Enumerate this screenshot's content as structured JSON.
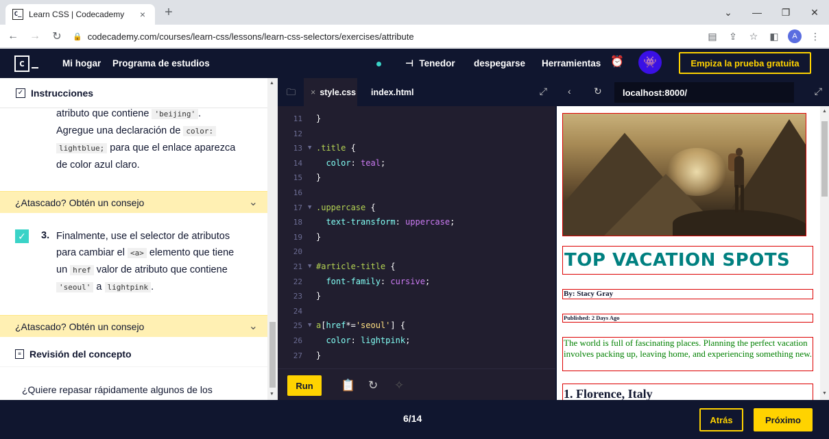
{
  "browser": {
    "tab_title": "Learn CSS | Codecademy",
    "favicon_text": "C_",
    "url": "codecademy.com/courses/learn-css/lessons/learn-css-selectors/exercises/attribute",
    "profile_initial": "A"
  },
  "header": {
    "logo_text": "c",
    "home": "Mi hogar",
    "catalog": "Programa de estudios",
    "fork": "Tenedor",
    "takeoff": "despegarse",
    "tools": "Herramientas",
    "trial_button": "Empiza la prueba gratuita"
  },
  "instructions": {
    "heading": "Instrucciones",
    "step2_text_a": "atributo que contiene",
    "step2_code_a": "'beijing'",
    "step2_text_b": "Agregue una declaración de",
    "step2_code_b": "color:",
    "step2_code_c": "lightblue;",
    "step2_text_c": "para que el enlace aparezca",
    "step2_text_d": "de color azul claro.",
    "hint_label": "¿Atascado? Obtén un consejo",
    "step3_num": "3.",
    "step3_text_a": "Finalmente, use el selector de atributos",
    "step3_text_b": "para cambiar el",
    "step3_code_a": "<a>",
    "step3_text_c": "elemento que tiene",
    "step3_text_d": "un",
    "step3_code_b": "href",
    "step3_text_e": "valor de atributo que contiene",
    "step3_code_c": "'seoul'",
    "step3_text_f": "a",
    "step3_code_d": "lightpink",
    "concept_heading": "Revisión del concepto",
    "concept_text": "¿Quiere repasar rápidamente algunos de los conceptos"
  },
  "editor": {
    "tabs": [
      "style.css",
      "index.html"
    ],
    "lines": [
      {
        "n": "11",
        "fold": false,
        "parts": [
          [
            "punc",
            "}"
          ]
        ]
      },
      {
        "n": "12",
        "fold": false,
        "parts": []
      },
      {
        "n": "13",
        "fold": true,
        "parts": [
          [
            "sel",
            ".title"
          ],
          [
            "punc",
            " {"
          ]
        ]
      },
      {
        "n": "14",
        "fold": false,
        "parts": [
          [
            "prop",
            "  color"
          ],
          [
            "punc",
            ": "
          ],
          [
            "val",
            "teal"
          ],
          [
            "punc",
            ";"
          ]
        ]
      },
      {
        "n": "15",
        "fold": false,
        "parts": [
          [
            "punc",
            "}"
          ]
        ]
      },
      {
        "n": "16",
        "fold": false,
        "parts": []
      },
      {
        "n": "17",
        "fold": true,
        "parts": [
          [
            "sel",
            ".uppercase"
          ],
          [
            "punc",
            " {"
          ]
        ]
      },
      {
        "n": "18",
        "fold": false,
        "parts": [
          [
            "prop",
            "  text-transform"
          ],
          [
            "punc",
            ": "
          ],
          [
            "val",
            "uppercase"
          ],
          [
            "punc",
            ";"
          ]
        ]
      },
      {
        "n": "19",
        "fold": false,
        "parts": [
          [
            "punc",
            "}"
          ]
        ]
      },
      {
        "n": "20",
        "fold": false,
        "parts": []
      },
      {
        "n": "21",
        "fold": true,
        "parts": [
          [
            "sel",
            "#article-title"
          ],
          [
            "punc",
            " {"
          ]
        ]
      },
      {
        "n": "22",
        "fold": false,
        "parts": [
          [
            "prop",
            "  font-family"
          ],
          [
            "punc",
            ": "
          ],
          [
            "val",
            "cursive"
          ],
          [
            "punc",
            ";"
          ]
        ]
      },
      {
        "n": "23",
        "fold": false,
        "parts": [
          [
            "punc",
            "}"
          ]
        ]
      },
      {
        "n": "24",
        "fold": false,
        "parts": []
      },
      {
        "n": "25",
        "fold": true,
        "parts": [
          [
            "sel",
            "a"
          ],
          [
            "punc",
            "["
          ],
          [
            "prop",
            "href"
          ],
          [
            "punc",
            "*="
          ],
          [
            "str",
            "'seoul'"
          ],
          [
            "punc",
            "] {"
          ]
        ]
      },
      {
        "n": "26",
        "fold": false,
        "parts": [
          [
            "prop",
            "  color"
          ],
          [
            "punc",
            ": "
          ],
          [
            "prop",
            "lightpink"
          ],
          [
            "punc",
            ";"
          ]
        ]
      },
      {
        "n": "27",
        "fold": false,
        "parts": [
          [
            "punc",
            "}"
          ]
        ]
      }
    ],
    "run_label": "Run"
  },
  "preview": {
    "url": "localhost:8000/",
    "title": "TOP VACATION SPOTS",
    "byline": "By: Stacy Gray",
    "published": "Published: 2 Days Ago",
    "intro": "The world is full of fascinating places. Planning the perfect vacation involves packing up, leaving home, and experiencing something new.",
    "first_heading": "1. Florence, Italy"
  },
  "footer": {
    "progress": "6/14",
    "back": "Atrás",
    "next": "Próximo"
  },
  "colors": {
    "navy": "#10162f",
    "yellow": "#ffd300",
    "teal_title": "#008080",
    "hint_bg": "#fff0b3",
    "editor_bg": "#211e2f"
  }
}
